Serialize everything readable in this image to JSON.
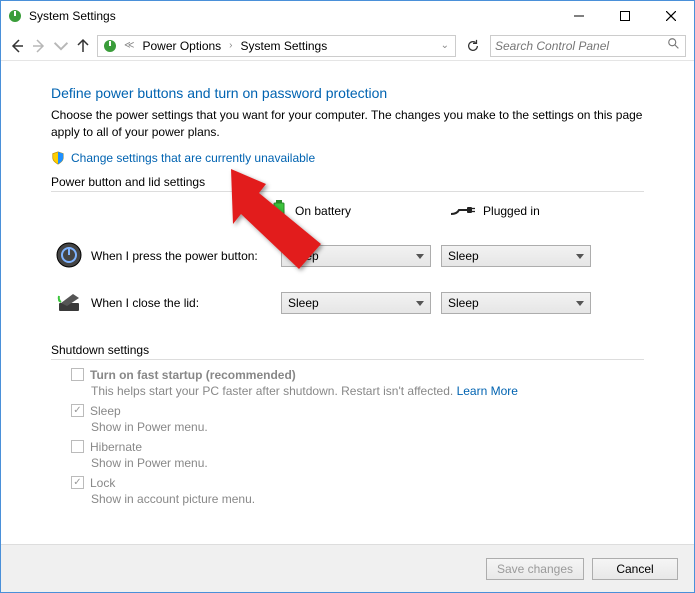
{
  "window": {
    "title": "System Settings"
  },
  "breadcrumb": {
    "item1": "Power Options",
    "item2": "System Settings"
  },
  "search": {
    "placeholder": "Search Control Panel"
  },
  "page": {
    "heading": "Define power buttons and turn on password protection",
    "description": "Choose the power settings that you want for your computer. The changes you make to the settings on this page apply to all of your power plans.",
    "change_link": "Change settings that are currently unavailable"
  },
  "power_button_section": {
    "title": "Power button and lid settings",
    "col_battery": "On battery",
    "col_plugged": "Plugged in",
    "row1_label": "When I press the power button:",
    "row1_battery": "Sleep",
    "row1_plugged": "Sleep",
    "row2_label": "When I close the lid:",
    "row2_battery": "Sleep",
    "row2_plugged": "Sleep"
  },
  "shutdown_section": {
    "title": "Shutdown settings",
    "fast_startup_label": "Turn on fast startup (recommended)",
    "fast_startup_desc": "This helps start your PC faster after shutdown. Restart isn't affected. ",
    "learn_more": "Learn More",
    "sleep_label": "Sleep",
    "sleep_desc": "Show in Power menu.",
    "hibernate_label": "Hibernate",
    "hibernate_desc": "Show in Power menu.",
    "lock_label": "Lock",
    "lock_desc": "Show in account picture menu."
  },
  "footer": {
    "save": "Save changes",
    "cancel": "Cancel"
  }
}
